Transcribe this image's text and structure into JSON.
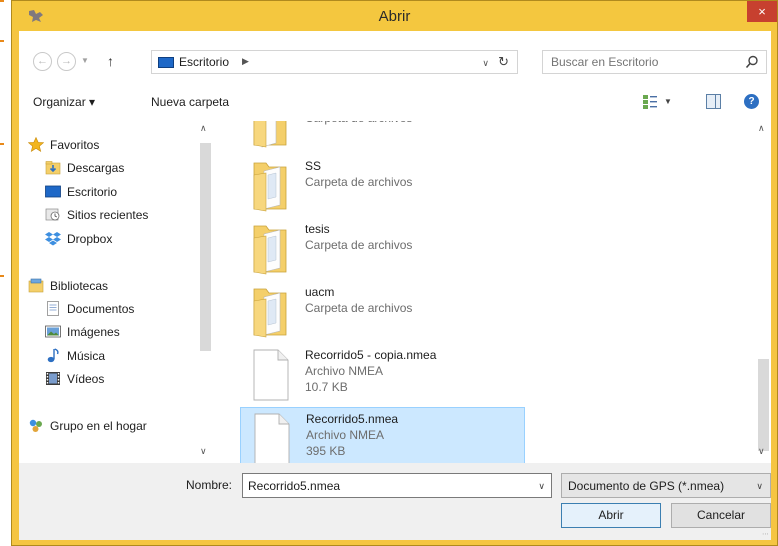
{
  "window": {
    "title": "Abrir",
    "close_label": "×"
  },
  "address_bar": {
    "crumb": "Escritorio",
    "search_placeholder": "Buscar en Escritorio"
  },
  "toolbar": {
    "organize_label": "Organizar ▾",
    "new_folder_label": "Nueva carpeta"
  },
  "nav": {
    "items": [
      {
        "label": "Favoritos",
        "icon": "star-icon",
        "level": "top"
      },
      {
        "label": "Descargas",
        "icon": "downloads-folder-icon",
        "level": "child"
      },
      {
        "label": "Escritorio",
        "icon": "desktop-icon",
        "level": "child"
      },
      {
        "label": "Sitios recientes",
        "icon": "recent-places-icon",
        "level": "child"
      },
      {
        "label": "Dropbox",
        "icon": "dropbox-icon",
        "level": "child"
      },
      {
        "label": "Bibliotecas",
        "icon": "library-icon",
        "level": "top"
      },
      {
        "label": "Documentos",
        "icon": "documents-icon",
        "level": "child"
      },
      {
        "label": "Imágenes",
        "icon": "pictures-icon",
        "level": "child"
      },
      {
        "label": "Música",
        "icon": "music-icon",
        "level": "child"
      },
      {
        "label": "Vídeos",
        "icon": "videos-icon",
        "level": "child"
      },
      {
        "label": "Grupo en el hogar",
        "icon": "homegroup-icon",
        "level": "top"
      }
    ]
  },
  "files": [
    {
      "name": "",
      "type": "Carpeta de archivos",
      "size": "",
      "kind": "folder",
      "partial": true
    },
    {
      "name": "SS",
      "type": "Carpeta de archivos",
      "size": "",
      "kind": "folder"
    },
    {
      "name": "tesis",
      "type": "Carpeta de archivos",
      "size": "",
      "kind": "folder"
    },
    {
      "name": "uacm",
      "type": "Carpeta de archivos",
      "size": "",
      "kind": "folder"
    },
    {
      "name": "Recorrido5 - copia.nmea",
      "type": "Archivo NMEA",
      "size": "10.7 KB",
      "kind": "file"
    },
    {
      "name": "Recorrido5.nmea",
      "type": "Archivo NMEA",
      "size": "395 KB",
      "kind": "file",
      "selected": true
    }
  ],
  "bottom": {
    "name_label": "Nombre:",
    "name_value": "Recorrido5.nmea",
    "filter_value": "Documento de GPS (*.nmea)",
    "open_label": "Abrir",
    "cancel_label": "Cancelar"
  },
  "colors": {
    "title_bar": "#f4c73f",
    "close": "#c7402f",
    "selection": "#cce8ff",
    "selection_border": "#99d1ff",
    "folder": "#f4cf6a"
  }
}
